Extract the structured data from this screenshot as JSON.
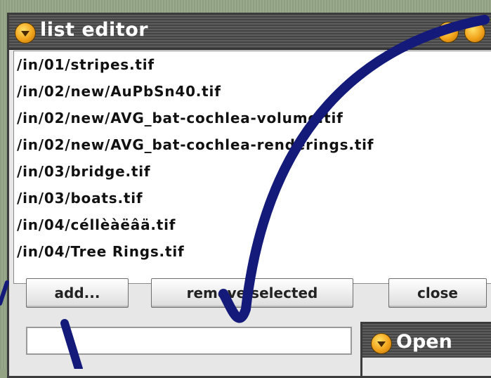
{
  "list_editor": {
    "title": "list editor",
    "items": [
      "/in/01/stripes.tif",
      "/in/02/new/AuPbSn40.tif",
      "/in/02/new/AVG_bat-cochlea-volume.tif",
      "/in/02/new/AVG_bat-cochlea-renderings.tif",
      "/in/03/bridge.tif",
      "/in/03/boats.tif",
      "/in/04/céllèàëâä.tif",
      "/in/04/Tree Rings.tif"
    ],
    "buttons": {
      "add": "add...",
      "remove": "remove selected",
      "close": "close"
    },
    "input_value": ""
  },
  "open_dialog": {
    "title": "Open"
  },
  "colors": {
    "background": "#93a384",
    "titlebar": "#4d4d4d",
    "window": "#e7e7e7",
    "annotation_arrow": "#141a7a",
    "menu_button": "#f1a21a"
  },
  "icons": {
    "window_menu": "orange-dropdown-icon",
    "window_controls": "orange-circle-icon"
  }
}
